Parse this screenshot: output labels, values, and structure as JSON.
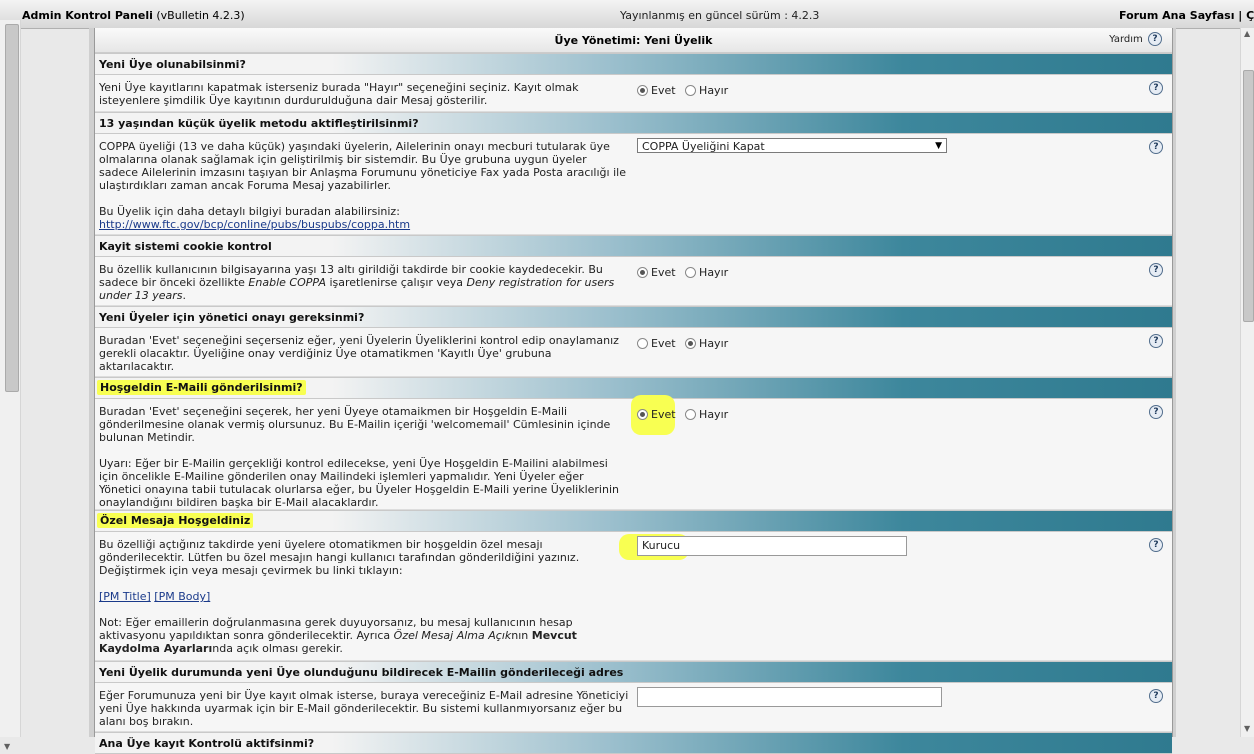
{
  "topbar": {
    "title": "Admin Kontrol Paneli",
    "version_suffix": "(vBulletin 4.2.3)",
    "latest": "Yayınlanmış en güncel sürüm : 4.2.3",
    "links": "Forum Ana Sayfası | Çık"
  },
  "panel": {
    "title": "Üye Yönetimi: Yeni Üyelik",
    "help_label": "Yardım"
  },
  "sections": {
    "s1": {
      "title": "Yeni Üye olunabilsinmi?",
      "desc": "Yeni Üye kayıtlarını kapatmak isterseniz burada \"Hayır\" seçeneğini seçiniz. Kayıt olmak isteyenlere şimdilik Üye kayıtının durdurulduğuna dair Mesaj gösterilir.",
      "yes": "Evet",
      "no": "Hayır",
      "selected": "Evet"
    },
    "s2": {
      "title": "13 yaşından küçük üyelik metodu aktifleştirilsinmi?",
      "desc": "COPPA üyeliği (13 ve daha küçük) yaşındaki üyelerin, Ailelerinin onayı mecburi tutularak üye olmalarına olanak sağlamak için geliştirilmiş bir sistemdir. Bu Üye grubuna uygun üyeler sadece Ailelerinin imzasını taşıyan bir Anlaşma Forumunu yöneticiye Fax yada Posta aracılığı ile ulaştırdıkları zaman ancak Foruma Mesaj yazabilirler.",
      "desc2": "Bu Üyelik için daha detaylı bilgiyi buradan alabilirsiniz:",
      "link": "http://www.ftc.gov/bcp/conline/pubs/buspubs/coppa.htm",
      "select_value": "COPPA Üyeliğini Kapat"
    },
    "s3": {
      "title": "Kayit sistemi cookie kontrol",
      "desc_a": "Bu özellik kullanıcının bilgisayarına yaşı 13 altı girildiği takdirde bir cookie kaydedecekir. Bu sadece bir önceki özellikte ",
      "desc_em1": "Enable COPPA",
      "desc_b": " işaretlenirse çalışır veya ",
      "desc_em2": "Deny registration for users under 13 years",
      "desc_c": ".",
      "yes": "Evet",
      "no": "Hayır",
      "selected": "Evet"
    },
    "s4": {
      "title": "Yeni Üyeler için yönetici onayı gereksinmi?",
      "desc": "Buradan 'Evet' seçeneğini seçerseniz eğer, yeni Üyelerin Üyeliklerini kontrol edip onaylamanız gerekli olacaktır. Üyeliğine onay verdiğiniz Üye otamatikmen 'Kayıtlı Üye' grubuna aktarılacaktır.",
      "yes": "Evet",
      "no": "Hayır",
      "selected": "Hayır"
    },
    "s5": {
      "title": "Hoşgeldin E-Maili gönderilsinmi?",
      "desc": "Buradan 'Evet' seçeneğini seçerek, her yeni Üyeye otamaikmen bir Hoşgeldin E-Maili gönderilmesine olanak vermiş olursunuz. Bu E-Mailin içeriği 'welcomemail' Cümlesinin içinde bulunan Metindir.",
      "desc2": "Uyarı: Eğer bir E-Mailin gerçekliği kontrol edilecekse, yeni Üye Hoşgeldin E-Mailini alabilmesi için öncelikle E-Mailine gönderilen onay Mailindeki işlemleri yapmalıdır. Yeni Üyeler eğer Yönetici onayına tabii tutulacak olurlarsa eğer, bu Üyeler Hoşgeldin E-Maili yerine Üyeliklerinin onaylandığını bildiren başka bir E-Mail alacaklardır.",
      "yes": "Evet",
      "no": "Hayır",
      "selected": "Evet"
    },
    "s6": {
      "title": "Özel Mesaja Hoşgeldiniz",
      "desc": "Bu özelliği açtığınız takdirde yeni üyelere otomatikmen bir hoşgeldin özel mesajı gönderilecektir. Lütfen bu özel mesajın hangi kullanıcı tarafından gönderildiğini yazınız. Değiştirmek için veya mesajı çevirmek bu linki tıklayın:",
      "link1": "[PM Title]",
      "link2": "[PM Body]",
      "note_a": "Not: Eğer emaillerin doğrulanmasına gerek duyuyorsanız, bu mesaj kullanıcının hesap aktivasyonu yapıldıktan sonra gönderilecektir. Ayrıca ",
      "note_em": "Özel Mesaj Alma Açık",
      "note_b": "nın ",
      "note_strong": "Mevcut Kaydolma Ayarları",
      "note_c": "nda açık olması gerekir.",
      "input_value": "Kurucu"
    },
    "s7": {
      "title": "Yeni Üyelik durumunda yeni Üye olunduğunu bildirecek E-Mailin gönderileceği adres",
      "desc": "Eğer Forumunuza yeni bir Üye kayıt olmak isterse, buraya vereceğiniz E-Mail adresine Yöneticiyi yeni Üye hakkında uyarmak için bir E-Mail gönderilecektir. Bu sistemi kullanmıyorsanız eğer bu alanı boş bırakın.",
      "input_value": ""
    },
    "s8": {
      "title": "Ana Üye kayıt Kontrolü aktifsinmi?"
    }
  },
  "icons": {
    "help": "?",
    "select_arrow": "▼",
    "scroll_up": "▲",
    "scroll_down": "▼"
  },
  "colors": {
    "section_header_end": "#2f7a8f",
    "highlight": "#f8ff52"
  }
}
